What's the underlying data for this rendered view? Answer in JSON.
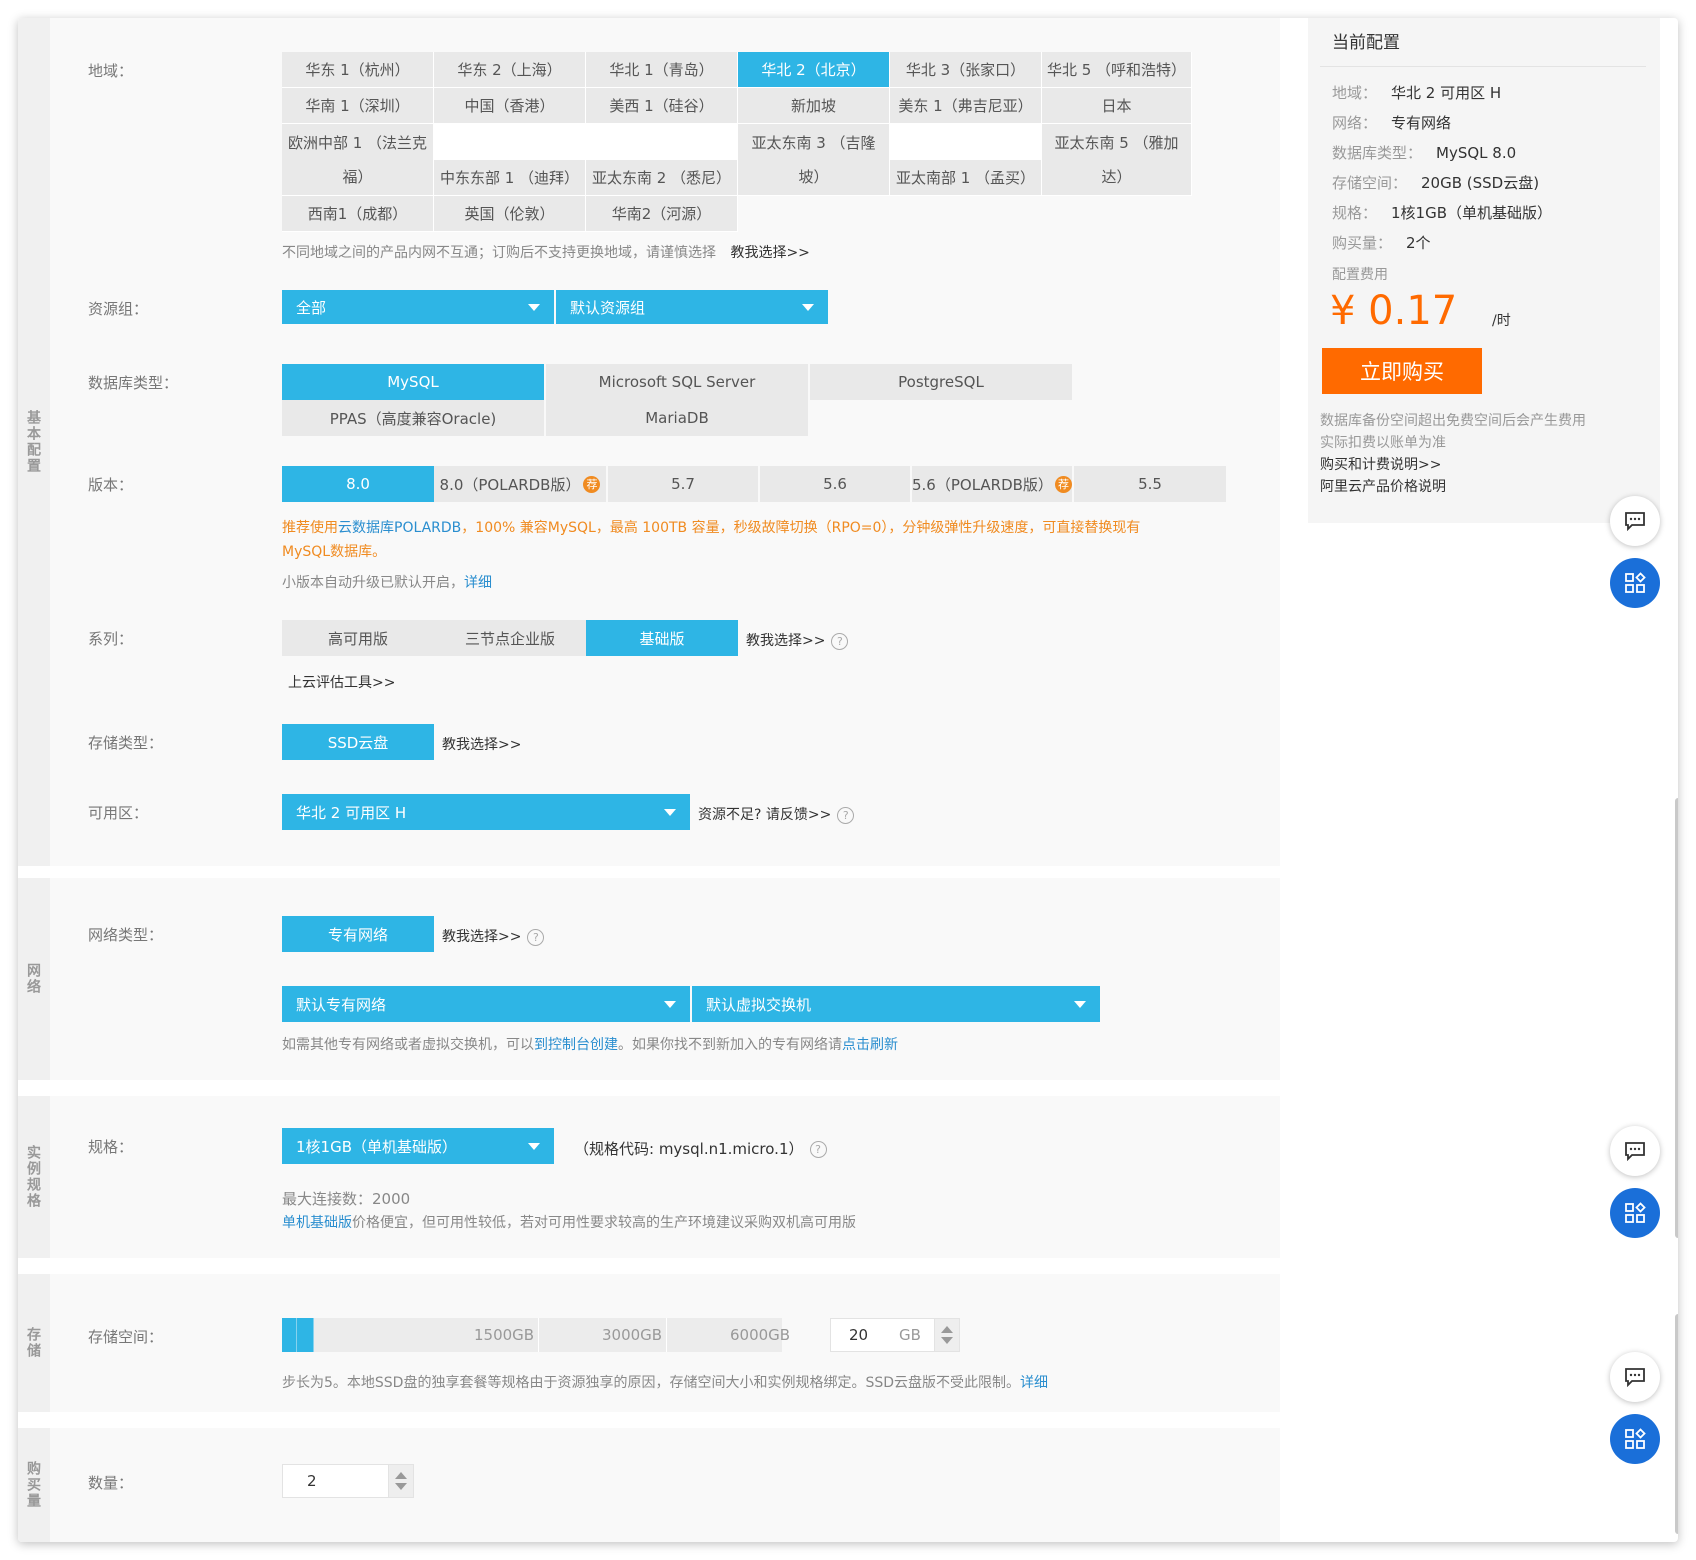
{
  "region": {
    "label": "地域：",
    "options": [
      "华东 1（杭州）",
      "华东 2（上海）",
      "华北 1（青岛）",
      "华北 2（北京）",
      "华北 3（张家口）",
      "华北 5 （呼和浩特）",
      "华南 1（深圳）",
      "中国（香港）",
      "美西 1（硅谷）",
      "新加坡",
      "美东 1（弗吉尼亚）",
      "日本",
      "欧洲中部 1 （法兰克",
      "福）",
      "中东东部 1 （迪拜）",
      "亚太东南 2 （悉尼）",
      "亚太东南 3 （吉隆",
      "坡）",
      "亚太南部 1 （孟买）",
      "亚太东南 5 （雅加",
      "达）",
      "西南1（成都）",
      "英国（伦敦）",
      "华南2（河源）"
    ],
    "selected": "华北 2（北京）",
    "hint": "不同地域之间的产品内网不互通；订购后不支持更换地域，请谨慎选择",
    "hint_link": "教我选择>>"
  },
  "resource_group": {
    "label": "资源组：",
    "first": "全部",
    "second": "默认资源组"
  },
  "db_type": {
    "label": "数据库类型：",
    "options": [
      "MySQL",
      "Microsoft SQL Server",
      "PostgreSQL",
      "PPAS（高度兼容Oracle)",
      "MariaDB"
    ],
    "selected": "MySQL"
  },
  "version": {
    "label": "版本：",
    "options": [
      "8.0",
      "8.0（POLARDB版）",
      "5.7",
      "5.6",
      "5.6（POLARDB版）",
      "5.5"
    ],
    "rec_badge": "荐",
    "selected": "8.0",
    "promo_1": "推荐使用",
    "promo_link": "云数据库POLARDB",
    "promo_2": "，100% 兼容MySQL，最高 100TB 容量，秒级故障切换（RPO=0），分钟级弹性升级速度，可直接替换现有",
    "promo_3": "MySQL数据库。",
    "note": "小版本自动升级已默认开启，",
    "note_link": "详细"
  },
  "series": {
    "label": "系列：",
    "options": [
      "高可用版",
      "三节点企业版",
      "基础版"
    ],
    "selected": "基础版",
    "help_link": "教我选择>>",
    "tool_link": "上云评估工具>>"
  },
  "storage_type": {
    "label": "存储类型：",
    "option": "SSD云盘",
    "help_link": "教我选择>>"
  },
  "zone": {
    "label": "可用区：",
    "value": "华北 2 可用区 H",
    "feedback": "资源不足? 请反馈>>"
  },
  "network": {
    "sidebar": "网络",
    "label": "网络类型：",
    "option": "专有网络",
    "help_link": "教我选择>>",
    "vpc": "默认专有网络",
    "vswitch": "默认虚拟交换机",
    "hint_1": "如需其他专有网络或者虚拟交换机，可以",
    "hint_link1": "到控制台创建",
    "hint_2": "。如果你找不到新加入的专有网络请",
    "hint_link2": "点击刷新"
  },
  "basic_sidebar": "基本配置",
  "spec": {
    "sidebar": "实例规格",
    "label": "规格：",
    "value": "1核1GB（单机基础版）",
    "code": "（规格代码: mysql.n1.micro.1）",
    "max_conn": "最大连接数：2000",
    "note_link": "单机基础版",
    "note": "价格便宜，但可用性较低，若对可用性要求较高的生产环境建议采购双机高可用版"
  },
  "storage": {
    "sidebar": "存储",
    "label": "存储空间：",
    "ticks": [
      "1500GB",
      "3000GB",
      "6000GB"
    ],
    "value": "20",
    "unit": "GB",
    "hint": "步长为5。本地SSD盘的独享套餐等规格由于资源独享的原因，存储空间大小和实例规格绑定。SSD云盘版不受此限制。",
    "hint_link": "详细"
  },
  "purchase": {
    "sidebar": "购买量",
    "label": "数量：",
    "value": "2"
  },
  "summary": {
    "title": "当前配置",
    "rows": [
      {
        "k": "地域：",
        "v": "华北 2 可用区 H"
      },
      {
        "k": "网络：",
        "v": "专有网络"
      },
      {
        "k": "数据库类型：",
        "v": "MySQL 8.0"
      },
      {
        "k": "存储空间：",
        "v": "20GB (SSD云盘)"
      },
      {
        "k": "规格：",
        "v": "1核1GB（单机基础版）"
      },
      {
        "k": "购买量：",
        "v": "2个"
      }
    ],
    "fee_label": "配置费用",
    "price": "¥ 0.17",
    "price_unit": "/时",
    "buy": "立即购买",
    "note1": "数据库备份空间超出免费空间后会产生费用",
    "note2": "实际扣费以账单为准",
    "link1": "购买和计费说明>>",
    "link2": "阿里云产品价格说明"
  },
  "colors": {
    "accent": "#2eb5e5",
    "orange": "#f08b21",
    "buy": "#ff6a00",
    "fab": "#1a6fd9"
  }
}
